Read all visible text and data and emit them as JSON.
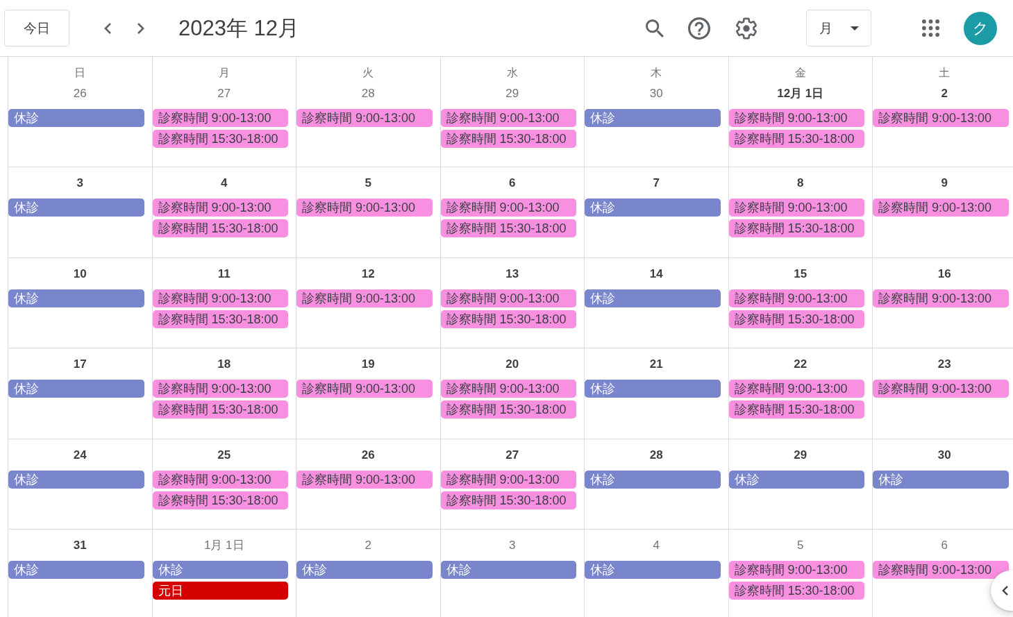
{
  "toolbar": {
    "today_button": "今日",
    "title": "2023年 12月",
    "view_selector": "月",
    "avatar": "ク"
  },
  "weekdays": [
    "日",
    "月",
    "火",
    "水",
    "木",
    "金",
    "土"
  ],
  "weeks": [
    {
      "days": [
        {
          "date": "26",
          "in_month": false,
          "events": [
            {
              "title": "休診",
              "color": "#7986cb"
            }
          ]
        },
        {
          "date": "27",
          "in_month": false,
          "events": [
            {
              "title": "診察時間 9:00-13:00",
              "color": "#f98fe0"
            },
            {
              "title": "診察時間 15:30-18:00",
              "color": "#f98fe0"
            }
          ]
        },
        {
          "date": "28",
          "in_month": false,
          "events": [
            {
              "title": "診察時間 9:00-13:00",
              "color": "#f98fe0"
            }
          ]
        },
        {
          "date": "29",
          "in_month": false,
          "events": [
            {
              "title": "診察時間 9:00-13:00",
              "color": "#f98fe0"
            },
            {
              "title": "診察時間 15:30-18:00",
              "color": "#f98fe0"
            }
          ]
        },
        {
          "date": "30",
          "in_month": false,
          "events": [
            {
              "title": "休診",
              "color": "#7986cb"
            }
          ]
        },
        {
          "date": "12月 1日",
          "in_month": true,
          "events": [
            {
              "title": "診察時間 9:00-13:00",
              "color": "#f98fe0"
            },
            {
              "title": "診察時間 15:30-18:00",
              "color": "#f98fe0"
            }
          ]
        },
        {
          "date": "2",
          "in_month": true,
          "events": [
            {
              "title": "診察時間 9:00-13:00",
              "color": "#f98fe0"
            }
          ]
        }
      ]
    },
    {
      "days": [
        {
          "date": "3",
          "in_month": true,
          "events": [
            {
              "title": "休診",
              "color": "#7986cb"
            }
          ]
        },
        {
          "date": "4",
          "in_month": true,
          "events": [
            {
              "title": "診察時間 9:00-13:00",
              "color": "#f98fe0"
            },
            {
              "title": "診察時間 15:30-18:00",
              "color": "#f98fe0"
            }
          ]
        },
        {
          "date": "5",
          "in_month": true,
          "events": [
            {
              "title": "診察時間 9:00-13:00",
              "color": "#f98fe0"
            }
          ]
        },
        {
          "date": "6",
          "in_month": true,
          "events": [
            {
              "title": "診察時間 9:00-13:00",
              "color": "#f98fe0"
            },
            {
              "title": "診察時間 15:30-18:00",
              "color": "#f98fe0"
            }
          ]
        },
        {
          "date": "7",
          "in_month": true,
          "events": [
            {
              "title": "休診",
              "color": "#7986cb"
            }
          ]
        },
        {
          "date": "8",
          "in_month": true,
          "events": [
            {
              "title": "診察時間 9:00-13:00",
              "color": "#f98fe0"
            },
            {
              "title": "診察時間 15:30-18:00",
              "color": "#f98fe0"
            }
          ]
        },
        {
          "date": "9",
          "in_month": true,
          "events": [
            {
              "title": "診察時間 9:00-13:00",
              "color": "#f98fe0"
            }
          ]
        }
      ]
    },
    {
      "days": [
        {
          "date": "10",
          "in_month": true,
          "events": [
            {
              "title": "休診",
              "color": "#7986cb"
            }
          ]
        },
        {
          "date": "11",
          "in_month": true,
          "events": [
            {
              "title": "診察時間 9:00-13:00",
              "color": "#f98fe0"
            },
            {
              "title": "診察時間 15:30-18:00",
              "color": "#f98fe0"
            }
          ]
        },
        {
          "date": "12",
          "in_month": true,
          "events": [
            {
              "title": "診察時間 9:00-13:00",
              "color": "#f98fe0"
            }
          ]
        },
        {
          "date": "13",
          "in_month": true,
          "events": [
            {
              "title": "診察時間 9:00-13:00",
              "color": "#f98fe0"
            },
            {
              "title": "診察時間 15:30-18:00",
              "color": "#f98fe0"
            }
          ]
        },
        {
          "date": "14",
          "in_month": true,
          "events": [
            {
              "title": "休診",
              "color": "#7986cb"
            }
          ]
        },
        {
          "date": "15",
          "in_month": true,
          "events": [
            {
              "title": "診察時間 9:00-13:00",
              "color": "#f98fe0"
            },
            {
              "title": "診察時間 15:30-18:00",
              "color": "#f98fe0"
            }
          ]
        },
        {
          "date": "16",
          "in_month": true,
          "events": [
            {
              "title": "診察時間 9:00-13:00",
              "color": "#f98fe0"
            }
          ]
        }
      ]
    },
    {
      "days": [
        {
          "date": "17",
          "in_month": true,
          "events": [
            {
              "title": "休診",
              "color": "#7986cb"
            }
          ]
        },
        {
          "date": "18",
          "in_month": true,
          "events": [
            {
              "title": "診察時間 9:00-13:00",
              "color": "#f98fe0"
            },
            {
              "title": "診察時間 15:30-18:00",
              "color": "#f98fe0"
            }
          ]
        },
        {
          "date": "19",
          "in_month": true,
          "events": [
            {
              "title": "診察時間 9:00-13:00",
              "color": "#f98fe0"
            }
          ]
        },
        {
          "date": "20",
          "in_month": true,
          "events": [
            {
              "title": "診察時間 9:00-13:00",
              "color": "#f98fe0"
            },
            {
              "title": "診察時間 15:30-18:00",
              "color": "#f98fe0"
            }
          ]
        },
        {
          "date": "21",
          "in_month": true,
          "events": [
            {
              "title": "休診",
              "color": "#7986cb"
            }
          ]
        },
        {
          "date": "22",
          "in_month": true,
          "events": [
            {
              "title": "診察時間 9:00-13:00",
              "color": "#f98fe0"
            },
            {
              "title": "診察時間 15:30-18:00",
              "color": "#f98fe0"
            }
          ]
        },
        {
          "date": "23",
          "in_month": true,
          "events": [
            {
              "title": "診察時間 9:00-13:00",
              "color": "#f98fe0"
            }
          ]
        }
      ]
    },
    {
      "days": [
        {
          "date": "24",
          "in_month": true,
          "events": [
            {
              "title": "休診",
              "color": "#7986cb"
            }
          ]
        },
        {
          "date": "25",
          "in_month": true,
          "events": [
            {
              "title": "診察時間 9:00-13:00",
              "color": "#f98fe0"
            },
            {
              "title": "診察時間 15:30-18:00",
              "color": "#f98fe0"
            }
          ]
        },
        {
          "date": "26",
          "in_month": true,
          "events": [
            {
              "title": "診察時間 9:00-13:00",
              "color": "#f98fe0"
            }
          ]
        },
        {
          "date": "27",
          "in_month": true,
          "events": [
            {
              "title": "診察時間 9:00-13:00",
              "color": "#f98fe0"
            },
            {
              "title": "診察時間 15:30-18:00",
              "color": "#f98fe0"
            }
          ]
        },
        {
          "date": "28",
          "in_month": true,
          "events": [
            {
              "title": "休診",
              "color": "#7986cb"
            }
          ]
        },
        {
          "date": "29",
          "in_month": true,
          "events": [
            {
              "title": "休診",
              "color": "#7986cb"
            }
          ]
        },
        {
          "date": "30",
          "in_month": true,
          "events": [
            {
              "title": "休診",
              "color": "#7986cb"
            }
          ]
        }
      ]
    },
    {
      "days": [
        {
          "date": "31",
          "in_month": true,
          "events": [
            {
              "title": "休診",
              "color": "#7986cb"
            }
          ]
        },
        {
          "date": "1月 1日",
          "in_month": false,
          "events": [
            {
              "title": "休診",
              "color": "#7986cb"
            },
            {
              "title": "元日",
              "color": "#d50000"
            }
          ]
        },
        {
          "date": "2",
          "in_month": false,
          "events": [
            {
              "title": "休診",
              "color": "#7986cb"
            }
          ]
        },
        {
          "date": "3",
          "in_month": false,
          "events": [
            {
              "title": "休診",
              "color": "#7986cb"
            }
          ]
        },
        {
          "date": "4",
          "in_month": false,
          "events": [
            {
              "title": "休診",
              "color": "#7986cb"
            }
          ]
        },
        {
          "date": "5",
          "in_month": false,
          "events": [
            {
              "title": "診察時間 9:00-13:00",
              "color": "#f98fe0"
            },
            {
              "title": "診察時間 15:30-18:00",
              "color": "#f98fe0"
            }
          ]
        },
        {
          "date": "6",
          "in_month": false,
          "events": [
            {
              "title": "診察時間 9:00-13:00",
              "color": "#f98fe0"
            }
          ]
        }
      ]
    }
  ]
}
